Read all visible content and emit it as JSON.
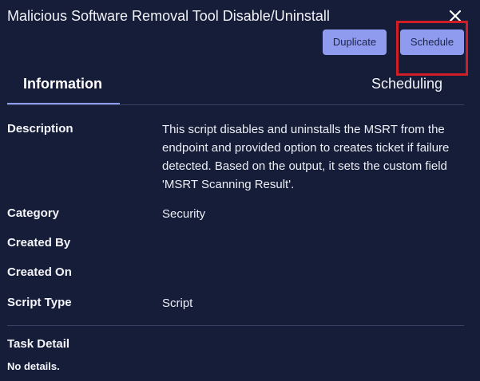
{
  "dialog": {
    "title": "Malicious Software Removal Tool Disable/Uninstall",
    "close_icon": "close-icon"
  },
  "actions": {
    "duplicate_label": "Duplicate",
    "schedule_label": "Schedule"
  },
  "tabs": [
    {
      "label": "Information",
      "active": true
    },
    {
      "label": "Scheduling",
      "active": false
    }
  ],
  "details": {
    "description_label": "Description",
    "description_value": "This script disables and uninstalls the MSRT from the endpoint and provided option to creates ticket if failure detected. Based on the output, it sets the custom field 'MSRT Scanning Result'.",
    "category_label": "Category",
    "category_value": "Security",
    "created_by_label": "Created By",
    "created_by_value": "",
    "created_on_label": "Created On",
    "created_on_value": "",
    "script_type_label": "Script Type",
    "script_type_value": "Script"
  },
  "task_detail": {
    "label": "Task Detail",
    "value": "No details."
  },
  "colors": {
    "background": "#161d38",
    "accent": "#8f9bef",
    "highlight": "#d01d26"
  }
}
